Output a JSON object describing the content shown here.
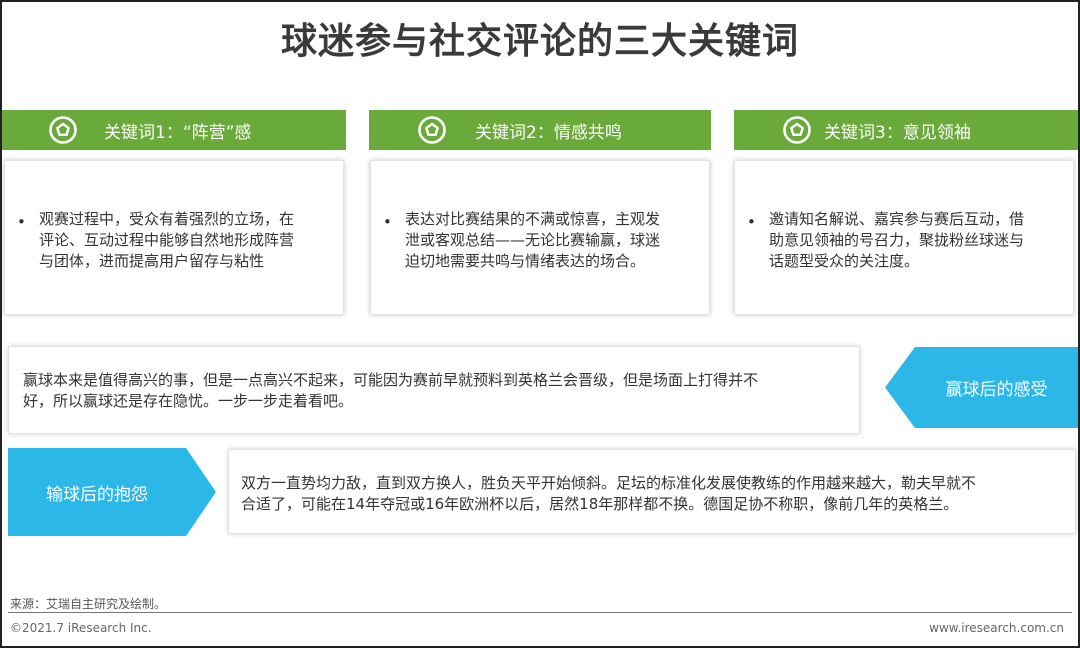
{
  "title": "球迷参与社交评论的三大关键词",
  "keywords": [
    {
      "header": "关键词1：“阵营”感",
      "icon": "football-icon",
      "bullet": "•",
      "lines": [
        "观赛过程中，受众有着强烈的立场，在",
        "评论、互动过程中能够自然地形成阵营",
        "与团体，进而提高用户留存与粘性"
      ]
    },
    {
      "header": "关键词2：情感共鸣",
      "icon": "football-icon",
      "bullet": "•",
      "lines": [
        "表达对比赛结果的不满或惊喜，主观发",
        "泄或客观总结——无论比赛输赢，球迷",
        "迫切地需要共鸣与情绪表达的场合。"
      ]
    },
    {
      "header": "关键词3：意见领袖",
      "icon": "football-icon",
      "bullet": "•",
      "lines": [
        "邀请知名解说、嘉宾参与赛后互动，借",
        "助意见领袖的号召力，聚拢粉丝球迷与",
        "话题型受众的关注度。"
      ]
    }
  ],
  "win": {
    "label": "赢球后的感受",
    "lines": [
      "赢球本来是值得高兴的事，但是一点高兴不起来，可能因为赛前早就预料到英格兰会晋级，但是场面上打得并不",
      "好，所以赢球还是存在隐忧。一步一步走着看吧。"
    ]
  },
  "lose": {
    "label": "输球后的抱怨",
    "lines": [
      "双方一直势均力敌，直到双方换人，胜负天平开始倾斜。足坛的标准化发展使教练的作用越来越大，勒夫早就不",
      "合适了，可能在14年夺冠或16年欧洲杯以后，居然18年那样都不换。德国足协不称职，像前几年的英格兰。"
    ]
  },
  "footer": {
    "source": "来源：艾瑞自主研究及绘制。",
    "copyright": "©2021.7 iResearch Inc.",
    "site": "www.iresearch.com.cn"
  },
  "colors": {
    "green": "#6aaa3a",
    "cyan": "#2bb8e8",
    "title": "#3a3a3a"
  }
}
